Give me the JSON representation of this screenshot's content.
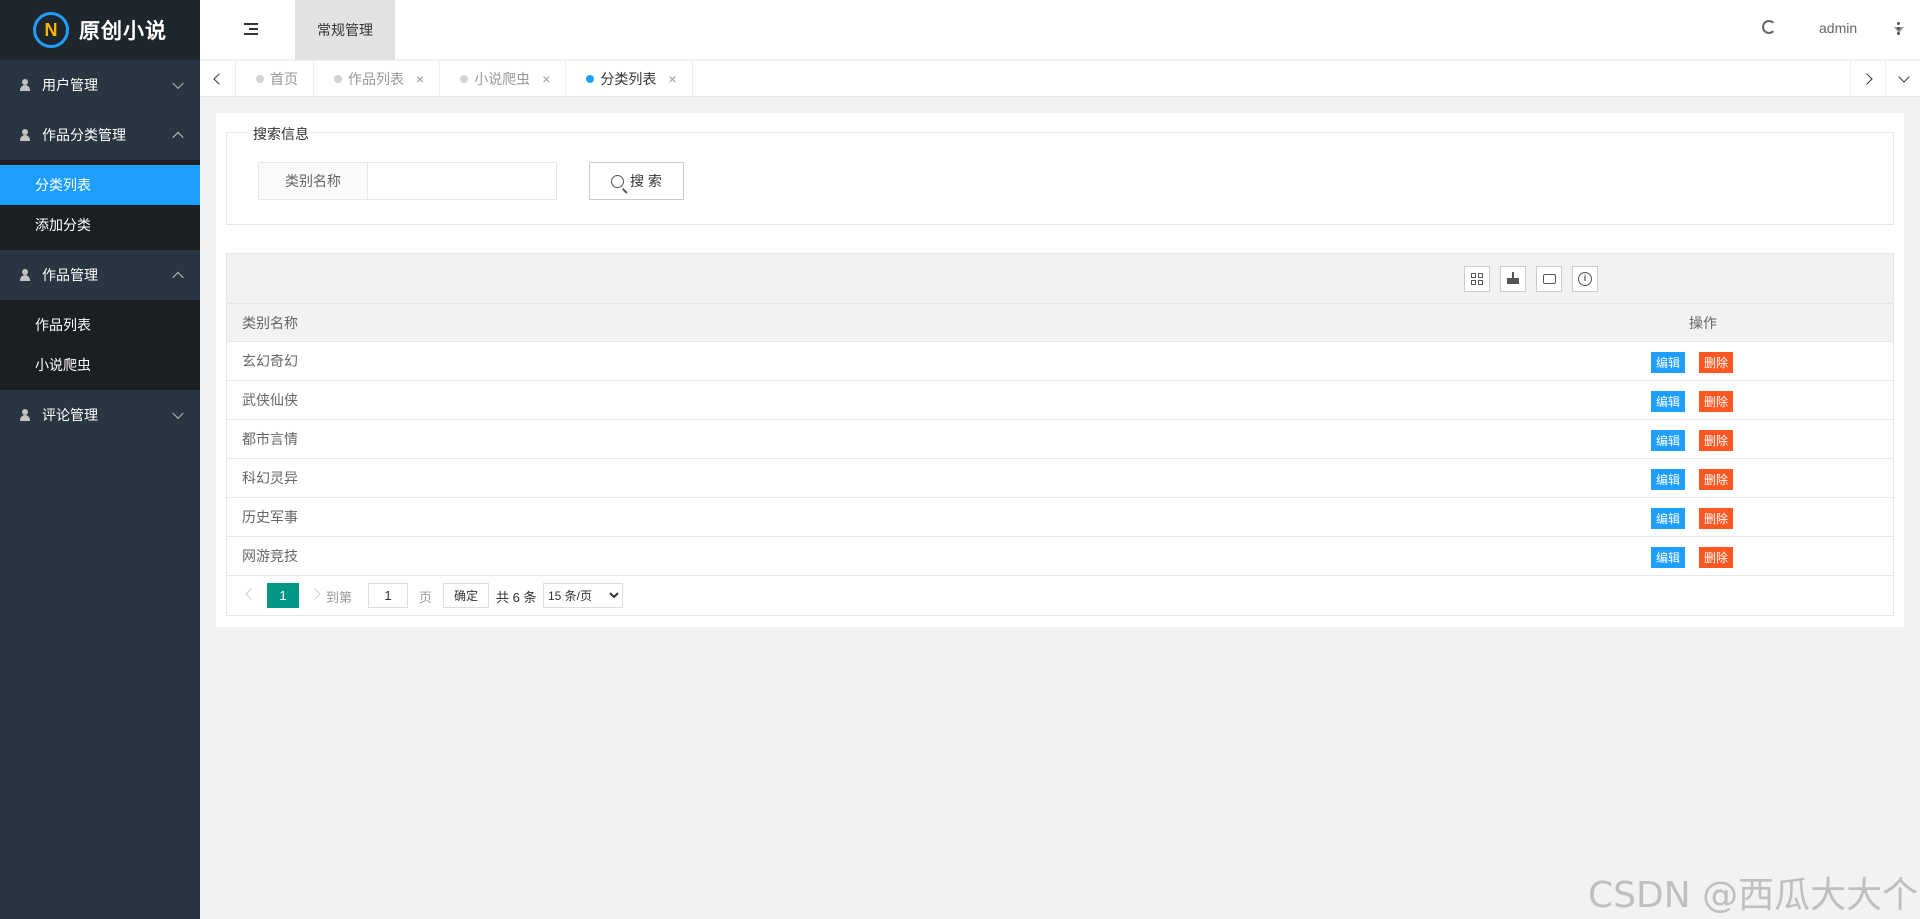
{
  "brand": {
    "logo_letter": "N",
    "title": "原创小说"
  },
  "sidebar": {
    "groups": [
      {
        "label": "用户管理",
        "expanded": false,
        "children": []
      },
      {
        "label": "作品分类管理",
        "expanded": true,
        "children": [
          {
            "label": "分类列表",
            "active": true
          },
          {
            "label": "添加分类",
            "active": false
          }
        ]
      },
      {
        "label": "作品管理",
        "expanded": true,
        "children": [
          {
            "label": "作品列表",
            "active": false
          },
          {
            "label": "小说爬虫",
            "active": false
          }
        ]
      },
      {
        "label": "评论管理",
        "expanded": false,
        "children": []
      }
    ]
  },
  "header": {
    "top_tab": "常规管理",
    "user": "admin"
  },
  "tabs": [
    {
      "label": "首页",
      "closable": false,
      "active": false
    },
    {
      "label": "作品列表",
      "closable": true,
      "active": false
    },
    {
      "label": "小说爬虫",
      "closable": true,
      "active": false
    },
    {
      "label": "分类列表",
      "closable": true,
      "active": true
    }
  ],
  "search": {
    "legend": "搜索信息",
    "field_label": "类别名称",
    "field_value": "",
    "button_label": "搜 索"
  },
  "table": {
    "headers": {
      "name": "类别名称",
      "op": "操作"
    },
    "rows": [
      "玄幻奇幻",
      "武侠仙侠",
      "都市言情",
      "科幻灵异",
      "历史军事",
      "网游竞技"
    ],
    "edit_label": "编辑",
    "delete_label": "删除"
  },
  "pager": {
    "current_page": "1",
    "goto_label": "到第",
    "page_label": "页",
    "goto_value": "1",
    "ok_label": "确定",
    "total_label": "共 6 条",
    "page_size_selected": "15 条/页",
    "page_size_options": [
      "15 条/页"
    ]
  },
  "watermark": "CSDN @西瓜大大个",
  "colors": {
    "accent": "#1e9fff",
    "danger": "#ff5722",
    "pager": "#009688",
    "sidebar": "#2a3542"
  }
}
